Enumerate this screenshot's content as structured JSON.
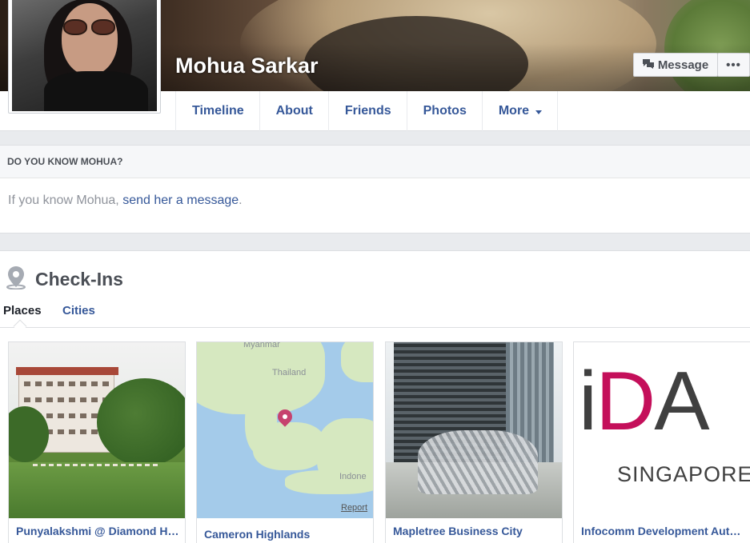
{
  "profile": {
    "name": "Mohua Sarkar"
  },
  "actions": {
    "message_label": "Message",
    "more_label": "•••"
  },
  "nav": {
    "tabs": [
      {
        "label": "Timeline"
      },
      {
        "label": "About"
      },
      {
        "label": "Friends"
      },
      {
        "label": "Photos"
      },
      {
        "label": "More"
      }
    ]
  },
  "know": {
    "header": "DO YOU KNOW MOHUA?",
    "prefix": "If you know Mohua, ",
    "link": "send her a message",
    "suffix": "."
  },
  "checkins": {
    "title": "Check-Ins",
    "tabs": {
      "places": "Places",
      "cities": "Cities"
    },
    "cards": [
      {
        "label": "Punyalakshmi @ Diamond Harbour"
      },
      {
        "label": "Cameron Highlands"
      },
      {
        "label": "Mapletree Business City"
      },
      {
        "label": "Infocomm Development Authority"
      }
    ],
    "map": {
      "labels": [
        "Myanmar",
        "Thailand",
        "Indone"
      ],
      "report": "Report"
    },
    "logo": {
      "i": "i",
      "d": "D",
      "a": "A",
      "subtitle": "SINGAPORE"
    }
  },
  "colors": {
    "link": "#365899",
    "page_bg": "#e9ebee",
    "logo_accent": "#c40f5a"
  }
}
